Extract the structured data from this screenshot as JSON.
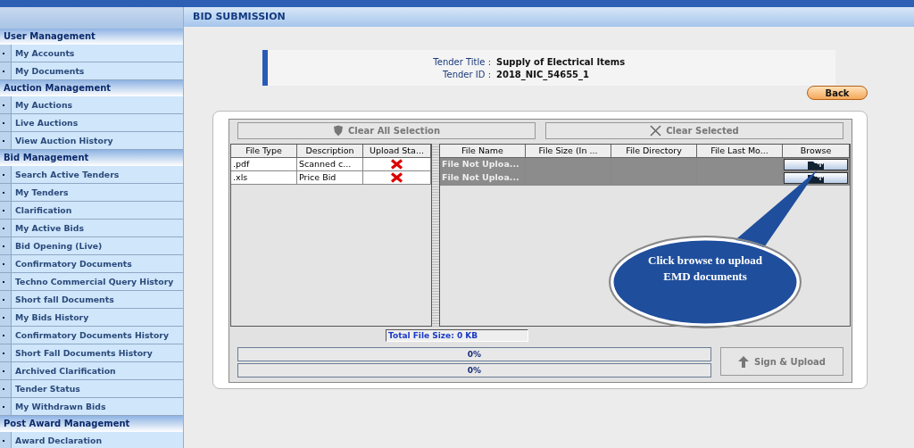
{
  "sidebar": {
    "sections": [
      {
        "title": "User Management",
        "items": [
          {
            "label": "My Accounts"
          },
          {
            "label": "My Documents"
          }
        ]
      },
      {
        "title": "Auction Management",
        "items": [
          {
            "label": "My Auctions"
          },
          {
            "label": "Live Auctions"
          },
          {
            "label": "View Auction History"
          }
        ]
      },
      {
        "title": "Bid Management",
        "items": [
          {
            "label": "Search Active Tenders"
          },
          {
            "label": "My Tenders"
          },
          {
            "label": "Clarification"
          },
          {
            "label": "My Active Bids"
          },
          {
            "label": "Bid Opening (Live)"
          },
          {
            "label": "Confirmatory Documents"
          },
          {
            "label": "Techno Commercial Query History"
          },
          {
            "label": "Short fall Documents"
          },
          {
            "label": "My Bids History"
          },
          {
            "label": "Confirmatory Documents History"
          },
          {
            "label": "Short Fall Documents History"
          },
          {
            "label": "Archived Clarification"
          },
          {
            "label": "Tender Status"
          },
          {
            "label": "My Withdrawn Bids"
          }
        ]
      },
      {
        "title": "Post Award Management",
        "items": [
          {
            "label": "Award Declaration"
          }
        ]
      }
    ]
  },
  "page": {
    "title": "BID SUBMISSION",
    "tender": [
      {
        "label": "Tender Title :",
        "value": "Supply of Electrical Items"
      },
      {
        "label": "Tender ID :",
        "value": "2018_NIC_54655_1"
      }
    ],
    "back_button": "Back",
    "toolbar": [
      {
        "label": "Clear All Selection"
      },
      {
        "label": "Clear Selected"
      }
    ],
    "left_table": {
      "columns": [
        "File Type",
        "Description",
        "Upload Sta..."
      ],
      "rows": [
        {
          "file_type": ".pdf",
          "description": "Scanned c...",
          "uploaded": false
        },
        {
          "file_type": ".xls",
          "description": "Price Bid",
          "uploaded": false
        }
      ]
    },
    "right_table": {
      "columns": [
        "File Name",
        "File Size (In ...",
        "File Directory",
        "File Last Mo...",
        "Browse"
      ],
      "rows": [
        {
          "file_name": "File Not Uploa..."
        },
        {
          "file_name": "File Not Uploa..."
        }
      ]
    },
    "total_size": "Total File Size: 0 KB",
    "progress": [
      {
        "level": 0,
        "reading": "0%"
      },
      {
        "level": 0,
        "reading": "0%"
      }
    ],
    "sign_upload_button": "Sign & Upload",
    "callout": "Click browse to upload EMD documents"
  }
}
